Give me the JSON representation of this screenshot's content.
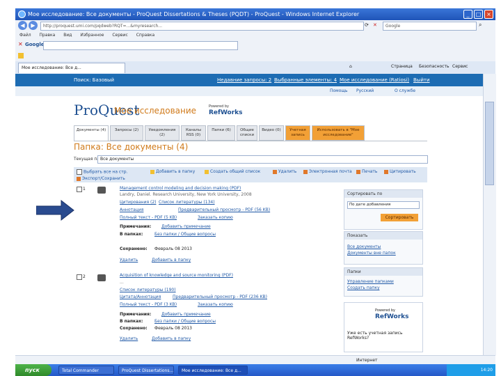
{
  "window": {
    "title": "Мое исследование: Все документы - ProQuest Dissertations & Theses (PQDT) - ProQuest - Windows Internet Explorer"
  },
  "address": {
    "url": "http://proquest.umi.com/pqdweb?RQT=...&myresearch...",
    "search_placeholder": "Google"
  },
  "menubar": {
    "items": [
      "Файл",
      "Правка",
      "Вид",
      "Избранное",
      "Сервис",
      "Справка"
    ]
  },
  "googlebar": {
    "label": "Google",
    "search": ""
  },
  "tab": {
    "title": "Мое исследование: Все д..."
  },
  "toolbar_right": {
    "page": "Страница",
    "safety": "Безопасность",
    "tools": "Сервис"
  },
  "proquest": {
    "topnav": {
      "search": "Поиск: Базовый",
      "recent": "Недавние запросы: 2",
      "marked": "Выбранные элементы: 4",
      "my_research": "Мое исследование (Ratiosi)",
      "exit": "Выйти"
    },
    "strip2": {
      "help": "Помощь",
      "russian": "Русский",
      "about": "О службе"
    },
    "logo": "ProQuest",
    "my_research_title": "Мое исследование",
    "powered_by": "Powered by",
    "refworks": "RefWorks",
    "tabs": [
      {
        "label": "Документы (4)"
      },
      {
        "label": "Запросы (2)"
      },
      {
        "label": "Уведомления (2)"
      },
      {
        "label": "Каналы RSS (0)"
      },
      {
        "label": "Папки (6)"
      },
      {
        "label": "Общие списки"
      },
      {
        "label": "Видео (0)"
      },
      {
        "label": "Учетная запись"
      },
      {
        "label": "Использовать в \"Мое исследование\""
      }
    ],
    "folder_title": "Папка: Все документы (4)",
    "current_folder_label": "Текущая папка:",
    "current_folder_value": "Все документы",
    "actions": [
      "Выбрать все на стр.",
      "Добавить в папку",
      "Создать общий список",
      "Удалить",
      "Электронная почта",
      "Печать",
      "Цитировать",
      "Экспорт/Сохранить"
    ],
    "records": [
      {
        "num": "1",
        "title": "Management control modeling and decision making (PDF)",
        "meta": "Landry, Daniel. Research University, New York University, 2008",
        "cited": "Цитирования (2)",
        "refs": "Список литературы (134)",
        "abstract": "Аннотация",
        "pdf_preview": "Предварительный просмотр - PDF (56 KB)",
        "fulltext": "Полный текст - PDF (5 KB)",
        "order": "Заказать копию",
        "notes_label": "Примечания:",
        "notes_value": "Добавить примечание",
        "folders_label": "В папках:",
        "folders_value": "Без папки / Общие вопросы",
        "saved_label": "Сохранено:",
        "saved_value": "Февраль 08 2013",
        "delete": "Удалить",
        "add_folder": "Добавить в папку"
      },
      {
        "num": "2",
        "title": "Acquisition of knowledge and source monitoring (PDF)",
        "meta": "...",
        "refs": "Список литературы (190)",
        "abstract": "Цитата/Аннотация",
        "pdf_preview": "Предварительный просмотр - PDF (236 KB)",
        "fulltext": "Полный текст - PDF (3 KB)",
        "order": "Заказать копию",
        "notes_label": "Примечания:",
        "notes_value": "Добавить примечание",
        "folders_label": "В папках:",
        "folders_value": "Без папки / Общие вопросы",
        "saved_label": "Сохранено:",
        "saved_value": "Февраль 08 2013",
        "delete": "Удалить",
        "add_folder": "Добавить в папку"
      }
    ],
    "sidebar": {
      "sort_title": "Сортировать по",
      "sort_value": "По дате добавления",
      "sort_button": "Сортировать",
      "show_title": "Показать",
      "show_links": [
        "Все документы",
        "Документы вне папок"
      ],
      "folder_title": "Папки",
      "folder_links": [
        "Управление папками",
        "Создать папку"
      ],
      "refworks_powered": "Powered by",
      "refworks_logo": "RefWorks",
      "refworks_text": "Уже есть учетная запись RefWorks?"
    }
  },
  "statusbar": {
    "text": "Интернет"
  },
  "taskbar": {
    "start": "пуск",
    "tasks": [
      "Total Commander",
      "ProQuest Dissertations...",
      "Мое исследование: Все д..."
    ],
    "clock": "14:20"
  }
}
